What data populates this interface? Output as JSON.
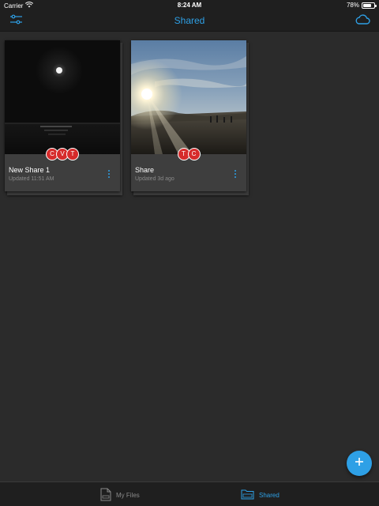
{
  "status_bar": {
    "carrier": "Carrier",
    "time": "8:24 AM",
    "battery_text": "78%",
    "battery_level": 0.78
  },
  "nav": {
    "title": "Shared",
    "left_icon": "sliders-icon",
    "right_icon": "cloud-icon"
  },
  "shares": [
    {
      "title": "New Share 1",
      "subtitle": "Updated 11:51 AM",
      "members": [
        "C",
        "V",
        "T"
      ],
      "thumbnail": "moon-night-beach"
    },
    {
      "title": "Share",
      "subtitle": "Updated 3d ago",
      "members": [
        "T",
        "C"
      ],
      "thumbnail": "sunset-beach"
    }
  ],
  "fab": {
    "icon": "plus-icon"
  },
  "tabs": [
    {
      "label": "My Files",
      "icon": "document-icon",
      "active": false
    },
    {
      "label": "Shared",
      "icon": "shared-folder-icon",
      "active": true
    }
  ],
  "colors": {
    "accent": "#2ea0e6",
    "background": "#2b2b2b",
    "bar": "#1f1f1f",
    "card": "#3e3e3e",
    "avatar": "#d62b2b",
    "muted_text": "#8a8a8a"
  }
}
